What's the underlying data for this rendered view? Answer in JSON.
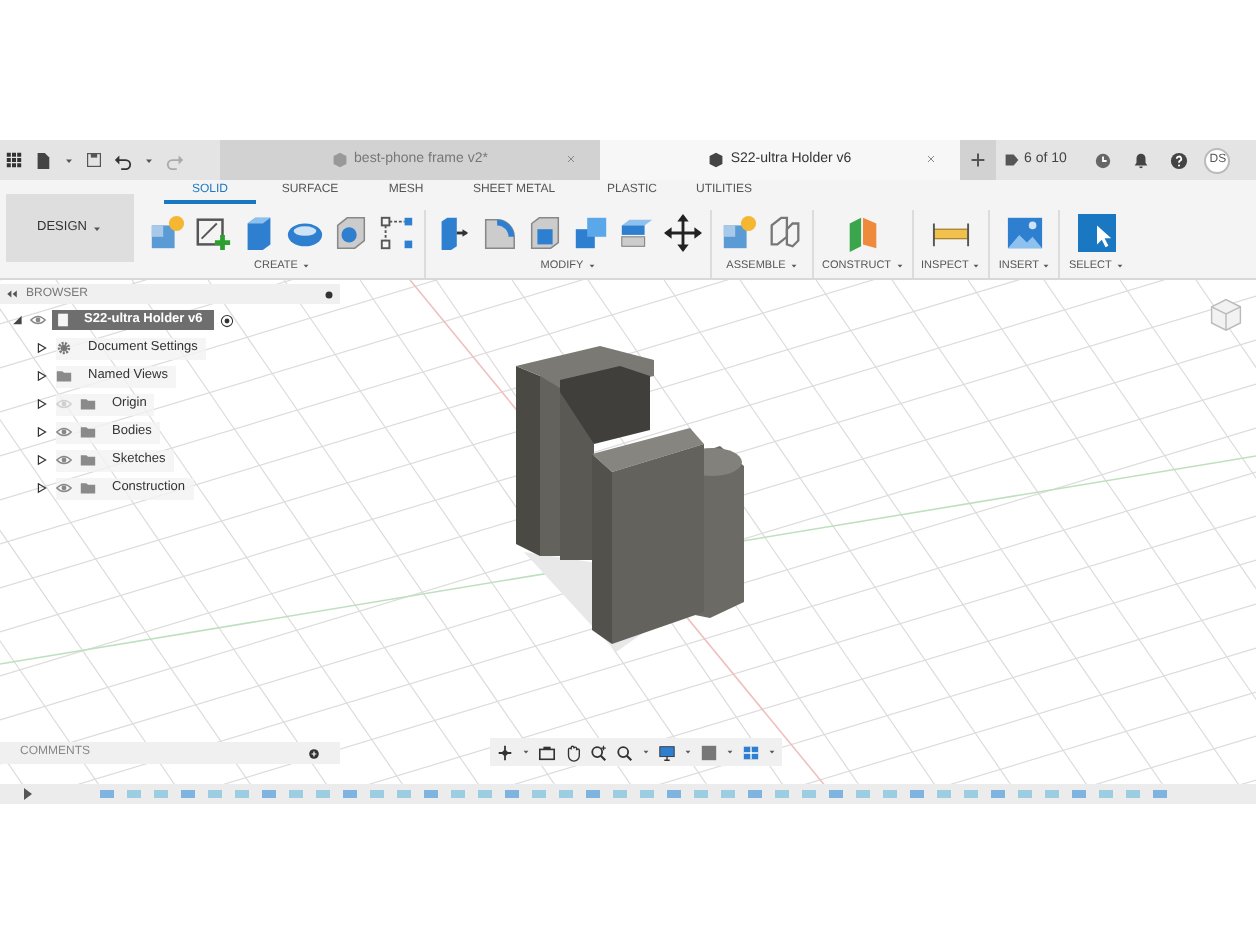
{
  "document_tabs": [
    {
      "label": "best-phone frame v2*",
      "selected": false
    },
    {
      "label": "S22-ultra Holder v6",
      "selected": true
    }
  ],
  "top_bar": {
    "job_count": "6 of 10",
    "user_initials": "DS"
  },
  "workspace": {
    "label": "DESIGN"
  },
  "ribbon_tabs": [
    {
      "label": "SOLID",
      "selected": true
    },
    {
      "label": "SURFACE",
      "selected": false
    },
    {
      "label": "MESH",
      "selected": false
    },
    {
      "label": "SHEET METAL",
      "selected": false
    },
    {
      "label": "PLASTIC",
      "selected": false
    },
    {
      "label": "UTILITIES",
      "selected": false
    }
  ],
  "ribbon_groups": [
    {
      "label": "CREATE",
      "tools": [
        {
          "kind": "component"
        },
        {
          "kind": "sketch"
        },
        {
          "kind": "extrude"
        },
        {
          "kind": "revolve"
        },
        {
          "kind": "hole"
        },
        {
          "kind": "pattern"
        }
      ]
    },
    {
      "label": "MODIFY",
      "tools": [
        {
          "kind": "presspull"
        },
        {
          "kind": "fillet"
        },
        {
          "kind": "shell"
        },
        {
          "kind": "combine"
        },
        {
          "kind": "split"
        },
        {
          "kind": "move"
        }
      ]
    },
    {
      "label": "ASSEMBLE",
      "tools": [
        {
          "kind": "component"
        },
        {
          "kind": "joint"
        }
      ]
    },
    {
      "label": "CONSTRUCT",
      "tools": [
        {
          "kind": "plane"
        }
      ]
    },
    {
      "label": "INSPECT",
      "tools": [
        {
          "kind": "measure"
        }
      ]
    },
    {
      "label": "INSERT",
      "tools": [
        {
          "kind": "image"
        }
      ]
    },
    {
      "label": "SELECT",
      "tools": [
        {
          "kind": "select"
        }
      ]
    }
  ],
  "browser": {
    "title": "BROWSER",
    "root": {
      "label": "S22-ultra Holder v6",
      "expanded": true,
      "children": [
        {
          "label": "Document Settings",
          "kind": "settings",
          "expanded": false
        },
        {
          "label": "Named Views",
          "kind": "views",
          "expanded": false
        },
        {
          "label": "Origin",
          "kind": "folder",
          "visible": false,
          "expanded": false
        },
        {
          "label": "Bodies",
          "kind": "folder",
          "visible": true,
          "expanded": false
        },
        {
          "label": "Sketches",
          "kind": "folder",
          "visible": true,
          "expanded": false
        },
        {
          "label": "Construction",
          "kind": "folder",
          "visible": true,
          "expanded": false
        }
      ]
    }
  },
  "comments": {
    "title": "COMMENTS"
  }
}
